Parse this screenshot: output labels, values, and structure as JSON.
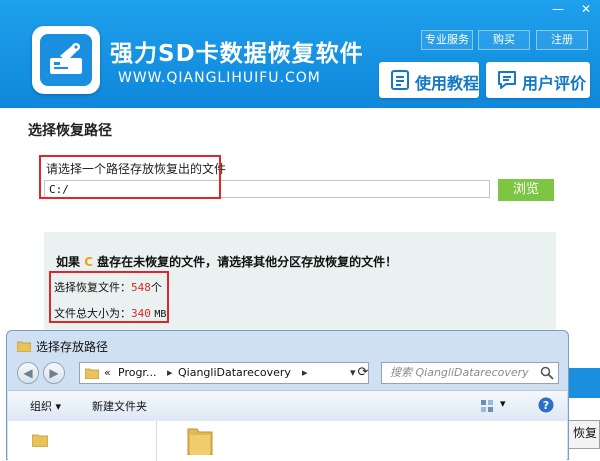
{
  "app": {
    "title": "强力SD卡数据恢复软件",
    "url": "WWW.QIANGLIHUIFU.COM"
  },
  "window_controls": {
    "minimize": "—",
    "close": "✕"
  },
  "top_links": [
    "专业服务",
    "购买",
    "注册"
  ],
  "big_buttons": {
    "tutorial": "使用教程",
    "review": "用户评价"
  },
  "main": {
    "section_title": "选择恢复路径",
    "path_prompt": "请选择一个路径存放恢复出的文件",
    "path_value": "C:/",
    "browse_label": "浏览",
    "warning_prefix": "如果 ",
    "warning_drive": "C",
    "warning_suffix": " 盘存在未恢复的文件，请选择其他分区存放恢复的文件！",
    "recover_files_label": "选择恢复文件：",
    "recover_files_count": "548",
    "recover_files_unit": "个",
    "total_size_label": "文件总大小为：",
    "total_size_value": "340",
    "total_size_unit": "MB",
    "partial_button_text": "恢复"
  },
  "dialog": {
    "title": "选择存放路径",
    "address": {
      "prefix": "«",
      "segment1": "Progr...",
      "segment2": "QiangliDatarecovery"
    },
    "search_placeholder": "搜索 QiangliDatarecovery",
    "toolbar": {
      "organize": "组织 ▾",
      "new_folder": "新建文件夹"
    }
  },
  "colors": {
    "header_blue": "#1a8fe0",
    "browse_green": "#7dc543",
    "highlight_red": "#e0262a",
    "drive_orange": "#f2a114"
  }
}
